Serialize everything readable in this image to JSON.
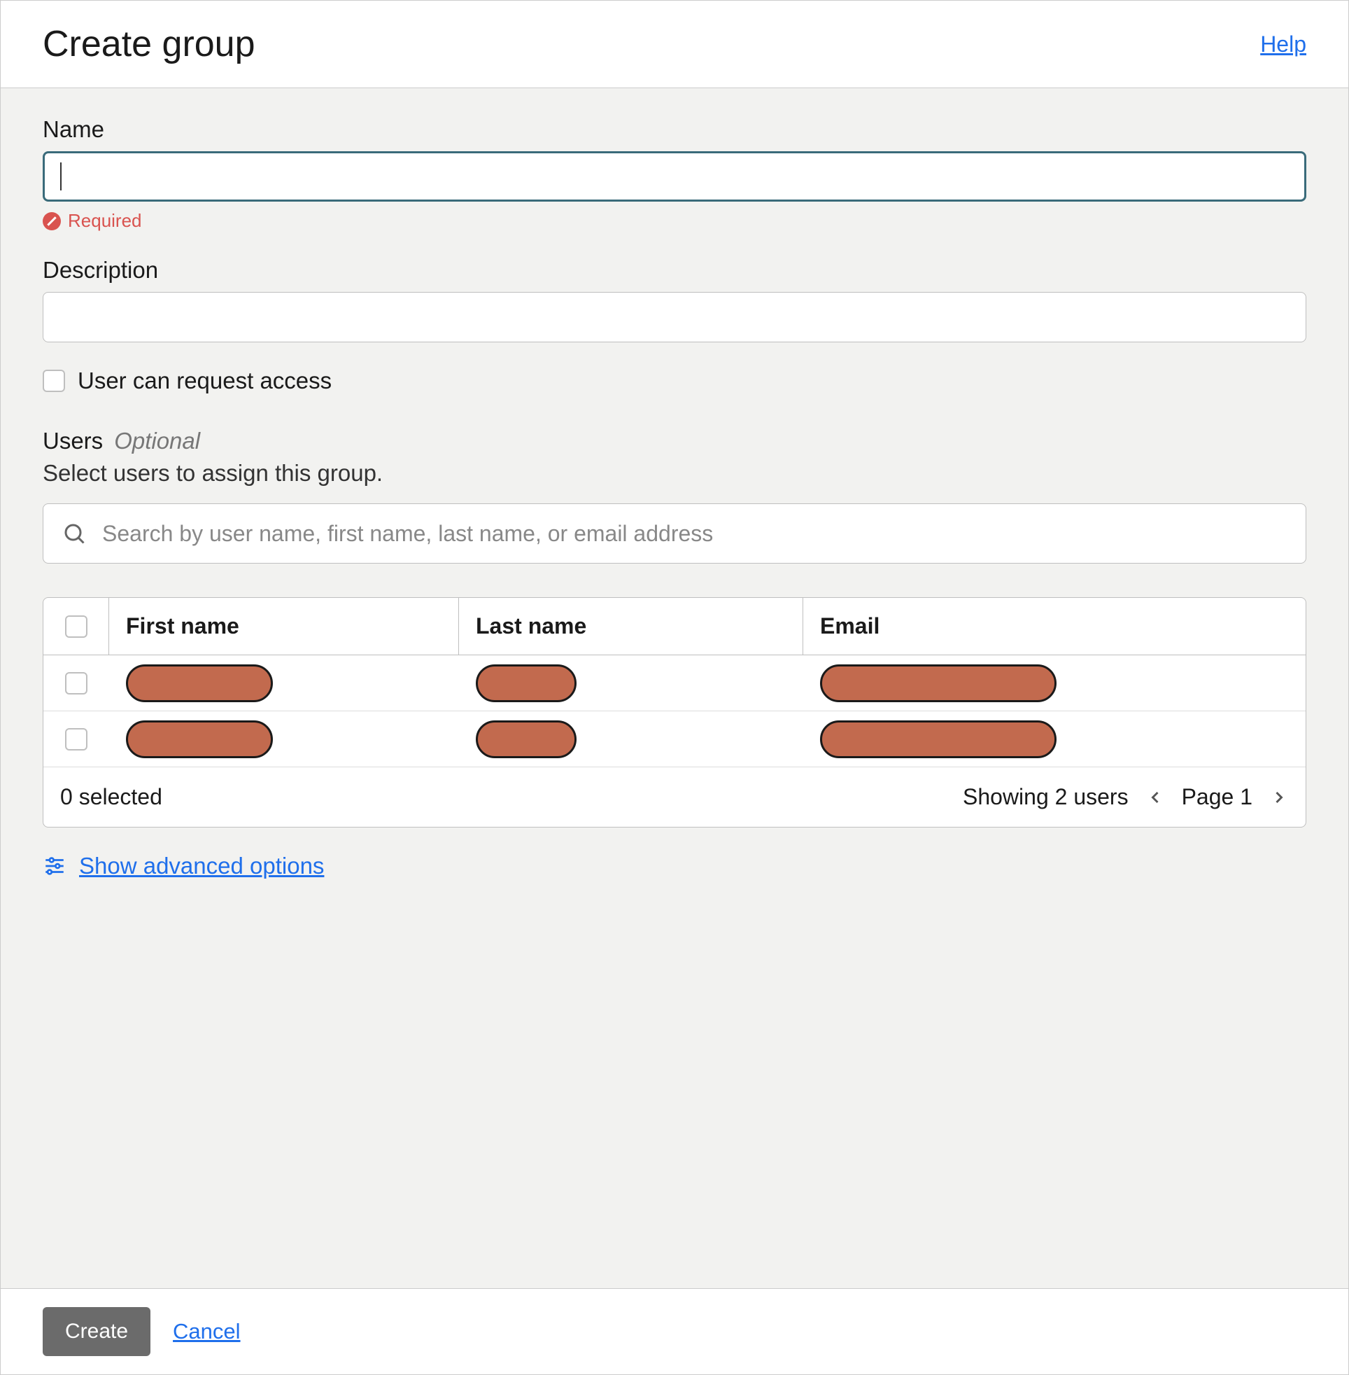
{
  "header": {
    "title": "Create group",
    "help": "Help"
  },
  "form": {
    "name_label": "Name",
    "name_value": "",
    "name_error": "Required",
    "description_label": "Description",
    "description_value": "",
    "request_access_label": "User can request access"
  },
  "users_section": {
    "title": "Users",
    "optional": "Optional",
    "description": "Select users to assign this group.",
    "search_placeholder": "Search by user name, first name, last name, or email address"
  },
  "table": {
    "columns": {
      "first": "First name",
      "last": "Last name",
      "email": "Email"
    },
    "rows": [
      {
        "first": "[redacted]",
        "last": "[redacted]",
        "email": "[redacted]"
      },
      {
        "first": "[redacted]",
        "last": "[redacted]",
        "email": "[redacted]"
      }
    ],
    "selected_text": "0 selected",
    "showing_text": "Showing 2 users",
    "page_text": "Page 1"
  },
  "advanced_link": "Show advanced options",
  "footer": {
    "create": "Create",
    "cancel": "Cancel"
  }
}
